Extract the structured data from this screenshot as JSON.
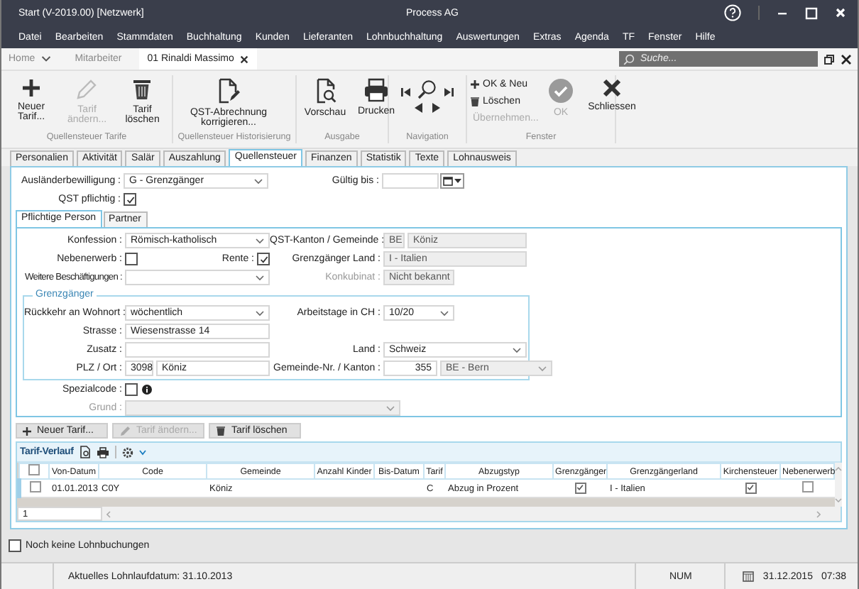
{
  "window": {
    "title": "Start (V-2019.00) [Netzwerk]",
    "app_name": "Process AG"
  },
  "menu": [
    "Datei",
    "Bearbeiten",
    "Stammdaten",
    "Buchhaltung",
    "Kunden",
    "Lieferanten",
    "Lohnbuchhaltung",
    "Auswertungen",
    "Extras",
    "Agenda",
    "TF",
    "Fenster",
    "Hilfe"
  ],
  "doc_tabs": [
    {
      "label": "Home",
      "selected": false,
      "kind": "home"
    },
    {
      "label": "Mitarbeiter",
      "selected": false,
      "kind": "plain"
    },
    {
      "label": "01 Rinaldi Massimo",
      "selected": true,
      "kind": "closable"
    }
  ],
  "search": {
    "placeholder": "Suche..."
  },
  "ribbon": {
    "groups": [
      {
        "label": "Quellensteuer Tarife",
        "kind": "large",
        "buttons": [
          {
            "label": "Neuer Tarif...",
            "disabled": false
          },
          {
            "label": "Tarif ändern...",
            "disabled": true
          },
          {
            "label": "Tarif löschen",
            "disabled": false
          }
        ]
      },
      {
        "label": "Quellensteuer Historisierung",
        "kind": "large",
        "buttons": [
          {
            "label": "QST-Abrechnung korrigieren...",
            "disabled": false
          }
        ]
      },
      {
        "label": "Ausgabe",
        "kind": "large",
        "buttons": [
          {
            "label": "Vorschau",
            "disabled": false
          },
          {
            "label": "Drucken",
            "disabled": false
          }
        ]
      },
      {
        "label": "Navigation",
        "kind": "navigation"
      },
      {
        "label": "Fenster",
        "kind": "mixed",
        "small_buttons": [
          {
            "label": "OK & Neu",
            "disabled": false
          },
          {
            "label": "Löschen",
            "disabled": false
          },
          {
            "label": "Übernehmen...",
            "disabled": true
          }
        ],
        "buttons": [
          {
            "label": "OK",
            "disabled": true
          },
          {
            "label": "Schliessen",
            "disabled": false
          }
        ]
      }
    ]
  },
  "tabs": [
    {
      "label": "Personalien",
      "selected": false
    },
    {
      "label": "Aktivität",
      "selected": false
    },
    {
      "label": "Salär",
      "selected": false
    },
    {
      "label": "Auszahlung",
      "selected": false
    },
    {
      "label": "Quellensteuer",
      "selected": true
    },
    {
      "label": "Finanzen",
      "selected": false
    },
    {
      "label": "Statistik",
      "selected": false
    },
    {
      "label": "Texte",
      "selected": false
    },
    {
      "label": "Lohnausweis",
      "selected": false
    }
  ],
  "auslaenderbewilligung": {
    "label": "Ausländerbewilligung :",
    "value": "G - Grenzgänger"
  },
  "gueltig_bis": {
    "label": "Gültig bis :"
  },
  "qst_pflichtig": {
    "label": "QST pflichtig :",
    "checked": true
  },
  "sub_tabs": [
    {
      "label": "Pflichtige Person",
      "selected": true
    },
    {
      "label": "Partner",
      "selected": false
    }
  ],
  "person": {
    "konfession": {
      "label": "Konfession :",
      "value": "Römisch-katholisch"
    },
    "qst_kanton": {
      "label": "QST-Kanton / Gemeinde :",
      "kanton": "BE",
      "gemeinde": "Köniz"
    },
    "nebenerwerb": {
      "label": "Nebenerwerb :",
      "checked": false
    },
    "rente": {
      "label": "Rente :",
      "checked": true
    },
    "grenzgaenger_land": {
      "label": "Grenzgänger Land :",
      "value": "I - Italien"
    },
    "weitere": {
      "label": "Weitere Beschäftigungen :"
    },
    "konkubinat": {
      "label": "Konkubinat :",
      "value": "Nicht bekannt"
    },
    "grenzgaenger": {
      "title": "Grenzgänger",
      "rueckkehr": {
        "label": "Rückkehr an Wohnort :",
        "value": "wöchentlich"
      },
      "arbeitstage": {
        "label": "Arbeitstage in CH :",
        "value": "10/20"
      },
      "strasse": {
        "label": "Strasse :",
        "value": "Wiesenstrasse 14"
      },
      "zusatz": {
        "label": "Zusatz :"
      },
      "land": {
        "label": "Land :",
        "value": "Schweiz"
      },
      "plz_ort": {
        "label": "PLZ / Ort :",
        "plz": "3098",
        "ort": "Köniz"
      },
      "gemeinde_nr": {
        "label": "Gemeinde-Nr. / Kanton :",
        "nr": "355",
        "kanton": "BE - Bern"
      }
    },
    "spezialcode": {
      "label": "Spezialcode :",
      "checked": false
    },
    "grund": {
      "label": "Grund :"
    }
  },
  "tarif_buttons": [
    {
      "label": "Neuer Tarif...",
      "disabled": false
    },
    {
      "label": "Tarif ändern...",
      "disabled": true
    },
    {
      "label": "Tarif löschen",
      "disabled": false
    }
  ],
  "grid": {
    "title": "Tarif-Verlauf",
    "select_all": {
      "checked": false
    },
    "columns": [
      "Von-Datum",
      "Code",
      "Gemeinde",
      "Anzahl Kinder",
      "Bis-Datum",
      "Tarif",
      "Abzugstyp",
      "Grenzgänger",
      "Grenzgängerland",
      "Kirchensteuer",
      "Nebenerwerb"
    ],
    "rows": [
      {
        "selected": false,
        "von": "01.01.2013",
        "code": "C0Y",
        "gemeinde": "Köniz",
        "tarif": "C",
        "abzugstyp": "Abzug in Prozent",
        "grenzgaenger": true,
        "land": "I - Italien",
        "kirchensteuer": true,
        "nebenerwerb": false
      }
    ],
    "footer": "1"
  },
  "noch_keine": {
    "label": "Noch keine Lohnbuchungen",
    "checked": false
  },
  "status_bar": {
    "text": "Aktuelles Lohnlaufdatum: 31.10.2013",
    "num": "NUM",
    "date": "31.12.2015",
    "time": "07:38"
  }
}
